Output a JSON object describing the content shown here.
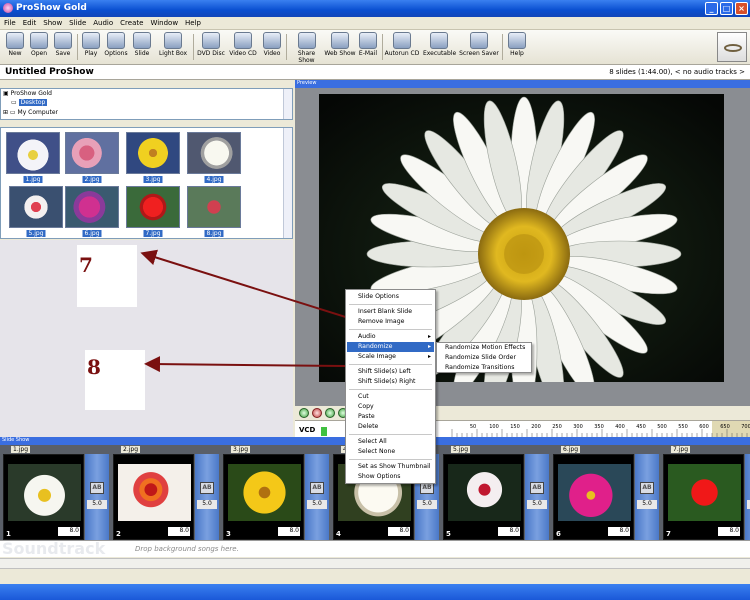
{
  "window": {
    "title": "ProShow Gold"
  },
  "menu": [
    "File",
    "Edit",
    "Show",
    "Slide",
    "Audio",
    "Create",
    "Window",
    "Help"
  ],
  "toolbar": [
    {
      "label": "New",
      "icon": "new-icon"
    },
    {
      "label": "Open",
      "icon": "open-icon"
    },
    {
      "label": "Save",
      "icon": "save-icon"
    },
    {
      "label": "Play",
      "icon": "play-icon"
    },
    {
      "label": "Options",
      "icon": "options-icon"
    },
    {
      "label": "Slide",
      "icon": "slide-icon"
    },
    {
      "label": "Light Box",
      "icon": "lightbox-icon"
    },
    {
      "label": "DVD Disc",
      "icon": "dvd-icon"
    },
    {
      "label": "Video CD",
      "icon": "videocd-icon"
    },
    {
      "label": "Video",
      "icon": "video-icon"
    },
    {
      "label": "Share Show",
      "icon": "share-icon"
    },
    {
      "label": "Web Show",
      "icon": "web-icon"
    },
    {
      "label": "E-Mail",
      "icon": "email-icon"
    },
    {
      "label": "Autorun CD",
      "icon": "autorun-icon"
    },
    {
      "label": "Executable",
      "icon": "executable-icon"
    },
    {
      "label": "Screen Saver",
      "icon": "screensaver-icon"
    },
    {
      "label": "Help",
      "icon": "help-icon"
    }
  ],
  "show": {
    "title": "Untitled ProShow",
    "info": "8 slides (1:44.00), < no audio tracks >"
  },
  "tree": {
    "root": "ProShow Gold",
    "selected": "Desktop",
    "item": "My Computer"
  },
  "files": [
    "1.jpg",
    "2.jpg",
    "3.jpg",
    "4.jpg",
    "5.jpg",
    "6.jpg",
    "7.jpg",
    "8.jpg"
  ],
  "annotations": {
    "label_a": "7",
    "label_b": "8"
  },
  "preview": {
    "header": "Preview"
  },
  "timeline": {
    "format": "VCD",
    "ticks": [
      "50",
      "100",
      "150",
      "200",
      "250",
      "300",
      "350",
      "400",
      "450",
      "500",
      "550",
      "600",
      "650",
      "700"
    ]
  },
  "slideshow": {
    "header": "Slide Show",
    "slides": [
      {
        "name": "1.jpg",
        "num": "1",
        "duration": "8.0",
        "transition": "5.0"
      },
      {
        "name": "2.jpg",
        "num": "2",
        "duration": "8.0",
        "transition": "5.0"
      },
      {
        "name": "3.jpg",
        "num": "3",
        "duration": "8.0",
        "transition": "5.0"
      },
      {
        "name": "4.jpg",
        "num": "4",
        "duration": "8.0",
        "transition": "5.0"
      },
      {
        "name": "5.jpg",
        "num": "5",
        "duration": "8.0",
        "transition": "5.0"
      },
      {
        "name": "6.jpg",
        "num": "6",
        "duration": "8.0",
        "transition": "5.0"
      },
      {
        "name": "7.jpg",
        "num": "7",
        "duration": "8.0",
        "transition": "5.0"
      }
    ],
    "transition_label": "AB"
  },
  "soundtrack": {
    "title": "Soundtrack",
    "hint": "Drop background songs here."
  },
  "context_menu": {
    "items": [
      {
        "label": "Slide Options",
        "type": "item"
      },
      {
        "type": "sep"
      },
      {
        "label": "Insert Blank Slide",
        "type": "item"
      },
      {
        "label": "Remove Image",
        "type": "item"
      },
      {
        "type": "sep"
      },
      {
        "label": "Audio",
        "type": "sub"
      },
      {
        "label": "Randomize",
        "type": "sub",
        "highlight": true
      },
      {
        "label": "Scale Image",
        "type": "sub"
      },
      {
        "type": "sep"
      },
      {
        "label": "Shift Slide(s) Left",
        "type": "item"
      },
      {
        "label": "Shift Slide(s) Right",
        "type": "item"
      },
      {
        "type": "sep"
      },
      {
        "label": "Cut",
        "type": "item"
      },
      {
        "label": "Copy",
        "type": "item"
      },
      {
        "label": "Paste",
        "type": "item"
      },
      {
        "label": "Delete",
        "type": "item"
      },
      {
        "type": "sep"
      },
      {
        "label": "Select All",
        "type": "item"
      },
      {
        "label": "Select None",
        "type": "item"
      },
      {
        "type": "sep"
      },
      {
        "label": "Set as Show Thumbnail",
        "type": "item"
      },
      {
        "label": "Show Options",
        "type": "item"
      }
    ],
    "submenu": [
      "Randomize Motion Effects",
      "Randomize Slide Order",
      "Randomize Transitions"
    ]
  },
  "colors": {
    "selection": "#316ac5",
    "annotation": "#7a1010",
    "titlebar": "#0a4fd0"
  }
}
